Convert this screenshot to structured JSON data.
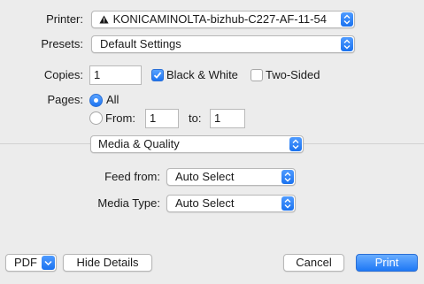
{
  "printer": {
    "label": "Printer:",
    "value": "KONICAMINOLTA-bizhub-C227-AF-11-54",
    "warning_icon": "warning-triangle-icon"
  },
  "presets": {
    "label": "Presets:",
    "value": "Default Settings"
  },
  "copies": {
    "label": "Copies:",
    "value": "1"
  },
  "black_white": {
    "label": "Black & White",
    "checked": true
  },
  "two_sided": {
    "label": "Two-Sided",
    "checked": false
  },
  "pages": {
    "label": "Pages:",
    "all_label": "All",
    "from_label": "From:",
    "from_value": "1",
    "to_label": "to:",
    "to_value": "1",
    "selected": "all"
  },
  "section": {
    "value": "Media & Quality"
  },
  "feed_from": {
    "label": "Feed from:",
    "value": "Auto Select"
  },
  "media_type": {
    "label": "Media Type:",
    "value": "Auto Select"
  },
  "footer": {
    "pdf_label": "PDF",
    "hide_details_label": "Hide Details",
    "cancel_label": "Cancel",
    "print_label": "Print"
  },
  "colors": {
    "accent": "#1e78f5",
    "background": "#ececec"
  }
}
